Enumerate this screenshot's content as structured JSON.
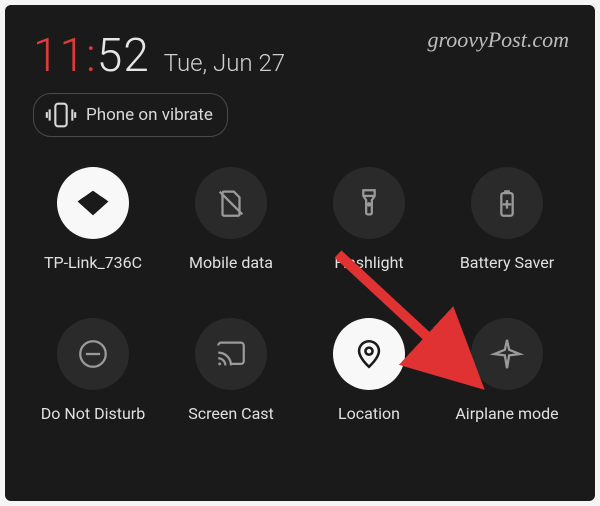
{
  "watermark": "groovyPost.com",
  "clock": {
    "hour": "11",
    "sep": ":",
    "min": "52"
  },
  "date": "Tue, Jun 27",
  "vibrate_label": "Phone on vibrate",
  "tiles": [
    {
      "key": "wifi",
      "label": "TP-Link_736C",
      "active": true
    },
    {
      "key": "mobiledata",
      "label": "Mobile data",
      "active": false
    },
    {
      "key": "flashlight",
      "label": "Flashlight",
      "active": false
    },
    {
      "key": "battery",
      "label": "Battery Saver",
      "active": false
    },
    {
      "key": "dnd",
      "label": "Do Not Disturb",
      "active": false
    },
    {
      "key": "cast",
      "label": "Screen Cast",
      "active": false
    },
    {
      "key": "location",
      "label": "Location",
      "active": true
    },
    {
      "key": "airplane",
      "label": "Airplane mode",
      "active": false
    }
  ],
  "annotation": {
    "arrow_color": "#e03232",
    "target_tile": "airplane"
  }
}
